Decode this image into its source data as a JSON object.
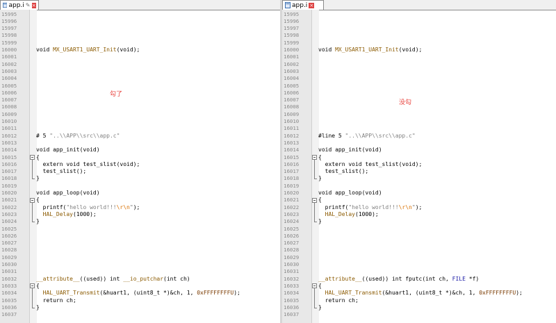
{
  "left": {
    "tab_label": "app.i",
    "annotation": "勾了",
    "line_numbers": [
      "15995",
      "15996",
      "15997",
      "15998",
      "15999",
      "16000",
      "16001",
      "16002",
      "16003",
      "16004",
      "16005",
      "16006",
      "16007",
      "16008",
      "16009",
      "16010",
      "16011",
      "16012",
      "16013",
      "16014",
      "16015",
      "16016",
      "16017",
      "16018",
      "16019",
      "16020",
      "16021",
      "16022",
      "16023",
      "16024",
      "16025",
      "16026",
      "16027",
      "16028",
      "16029",
      "16030",
      "16031",
      "16032",
      "16033",
      "16034",
      "16035",
      "16036",
      "16037"
    ],
    "code": {
      "l16000": [
        "void ",
        "MX_USART1_UART_Init",
        "(void);"
      ],
      "l16012": [
        "# 5 ",
        "\"..\\\\APP\\\\src\\\\app.c\""
      ],
      "l16014": "void app_init(void)",
      "l16015": "{",
      "l16016": "  extern void test_slist(void);",
      "l16017": "  test_slist();",
      "l16018": "}",
      "l16020": "void app_loop(void)",
      "l16021": "{",
      "l16022": [
        "  printf(",
        "\"hello world!!!",
        "\\r\\n",
        "\"",
        ");"
      ],
      "l16023": [
        "  ",
        "HAL_Delay",
        "(1000);"
      ],
      "l16024": "}",
      "l16032": [
        "__attribute__",
        "((used)) int ",
        "__io_putchar",
        "(int ch)"
      ],
      "l16033": "{",
      "l16034": [
        "  ",
        "HAL_UART_Transmit",
        "(&huart1, (uint8_t *)&ch, 1, ",
        "0xFFFFFFFFU",
        ");"
      ],
      "l16035": "  return ch;",
      "l16036": "}"
    }
  },
  "right": {
    "tab_label": "app.i",
    "annotation": "没勾",
    "line_numbers": [
      "15995",
      "15996",
      "15997",
      "15998",
      "15999",
      "16000",
      "16001",
      "16002",
      "16003",
      "16004",
      "16005",
      "16006",
      "16007",
      "16008",
      "16009",
      "16010",
      "16011",
      "16012",
      "16013",
      "16014",
      "16015",
      "16016",
      "16017",
      "16018",
      "16019",
      "16020",
      "16021",
      "16022",
      "16023",
      "16024",
      "16025",
      "16026",
      "16027",
      "16028",
      "16029",
      "16030",
      "16031",
      "16032",
      "16033",
      "16034",
      "16035",
      "16036",
      "16037"
    ],
    "code": {
      "l16000": [
        "void ",
        "MX_USART1_UART_Init",
        "(void);"
      ],
      "l16012": [
        "#line 5 ",
        "\"..\\\\APP\\\\src\\\\app.c\""
      ],
      "l16014": "void app_init(void)",
      "l16015": "{",
      "l16016": "  extern void test_slist(void);",
      "l16017": "  test_slist();",
      "l16018": "}",
      "l16020": "void app_loop(void)",
      "l16021": "{",
      "l16022": [
        "  printf(",
        "\"hello world!!!",
        "\\r\\n",
        "\"",
        ");"
      ],
      "l16023": [
        "  ",
        "HAL_Delay",
        "(1000);"
      ],
      "l16024": "}",
      "l16032": [
        "__attribute__",
        "((used)) int fputc(int ch, ",
        "FILE",
        " *f)"
      ],
      "l16033": "{",
      "l16034": [
        "  ",
        "HAL_UART_Transmit",
        "(&huart1, (uint8_t *)&ch, 1, ",
        "0xFFFFFFFFU",
        ");"
      ],
      "l16035": "  return ch;",
      "l16036": "}"
    }
  },
  "colors": {
    "function": "#8b5a00",
    "string": "#808080",
    "escape": "#d97000",
    "annotation": "#e8403b"
  }
}
